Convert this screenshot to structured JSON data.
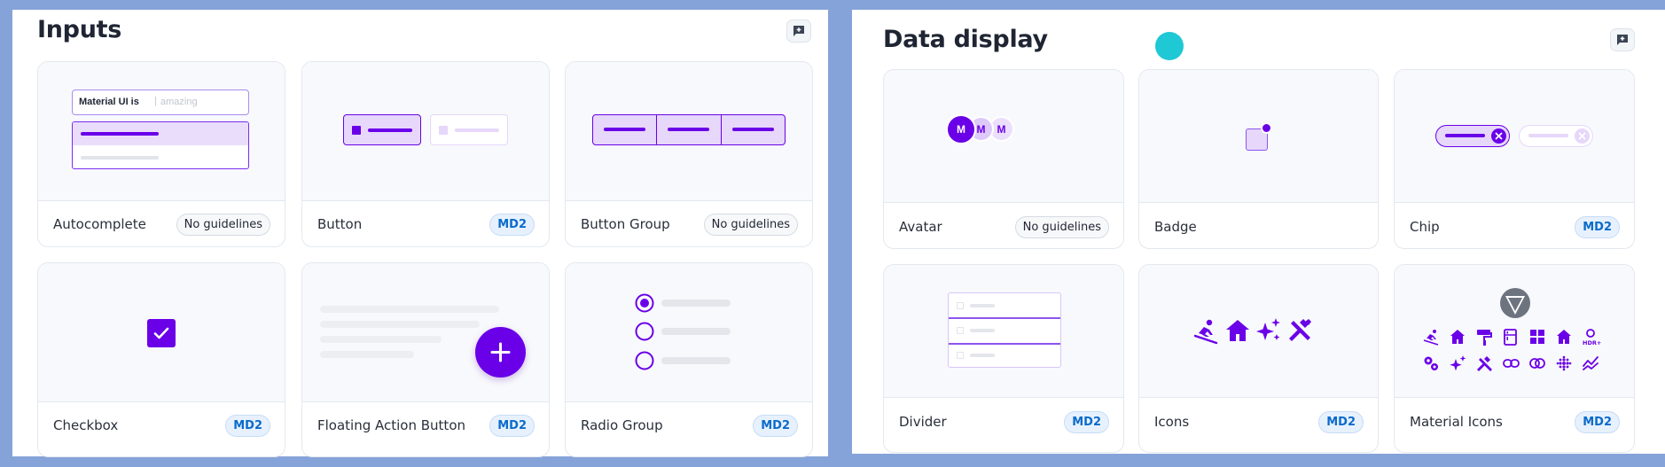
{
  "inputs": {
    "title": "Inputs",
    "cards": [
      {
        "label": "Autocomplete",
        "badge": "No guidelines"
      },
      {
        "label": "Button",
        "badge": "MD2"
      },
      {
        "label": "Button Group",
        "badge": "No guidelines"
      },
      {
        "label": "Checkbox",
        "badge": "MD2"
      },
      {
        "label": "Floating Action Button",
        "badge": "MD2"
      },
      {
        "label": "Radio Group",
        "badge": "MD2"
      }
    ],
    "autocomplete_preview": {
      "prefix": "Material UI is",
      "suggestion": "amazing"
    }
  },
  "data_display": {
    "title": "Data display",
    "cards": [
      {
        "label": "Avatar",
        "badge": "No guidelines"
      },
      {
        "label": "Badge",
        "badge": ""
      },
      {
        "label": "Chip",
        "badge": "MD2"
      },
      {
        "label": "Divider",
        "badge": "MD2"
      },
      {
        "label": "Icons",
        "badge": "MD2"
      },
      {
        "label": "Material Icons",
        "badge": "MD2"
      }
    ],
    "avatar_letters": [
      "M",
      "M",
      "M"
    ]
  },
  "colors": {
    "accent": "#6a00e8",
    "accent_light": "#e6d7fb",
    "md2_text": "#0b6bcb",
    "background": "#86a3d9",
    "dot": "#1ec8d4"
  }
}
